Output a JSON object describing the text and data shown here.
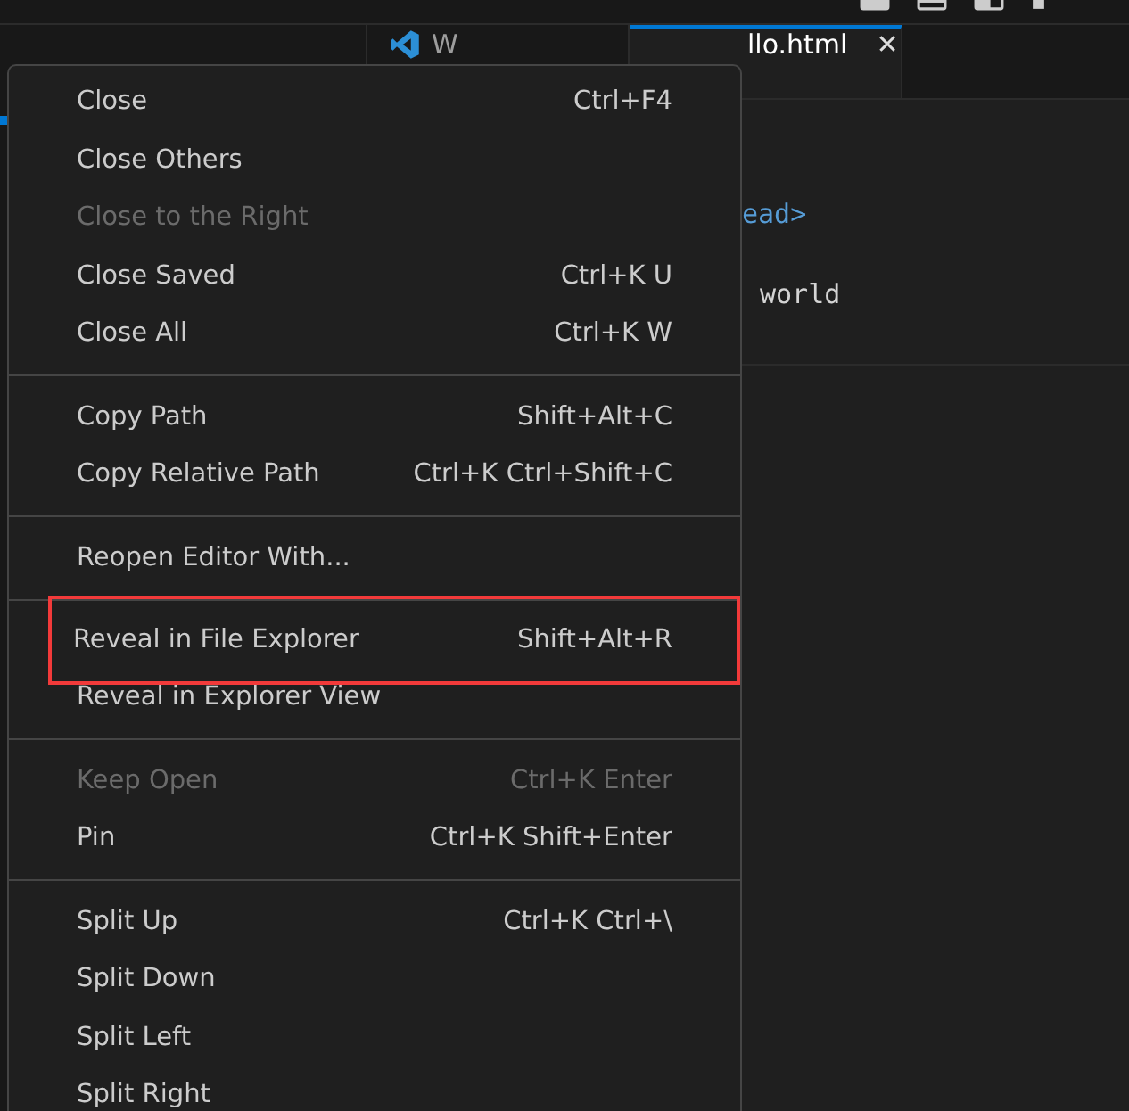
{
  "tabs": [
    {
      "label": "W",
      "selected": false
    },
    {
      "label": "llo.html",
      "selected": true,
      "close": "✕"
    }
  ],
  "editor": {
    "lines": [
      {
        "text": "ead>",
        "kind": "tag"
      },
      {
        "text": "world",
        "kind": "text"
      }
    ]
  },
  "context_menu": {
    "items": [
      {
        "kind": "item",
        "label": "Close",
        "shortcut": "Ctrl+F4",
        "disabled": false,
        "highlighted": false
      },
      {
        "kind": "item",
        "label": "Close Others",
        "disabled": false,
        "highlighted": false
      },
      {
        "kind": "item",
        "label": "Close to the Right",
        "disabled": true,
        "highlighted": false
      },
      {
        "kind": "item",
        "label": "Close Saved",
        "shortcut": "Ctrl+K U",
        "disabled": false,
        "highlighted": false
      },
      {
        "kind": "item",
        "label": "Close All",
        "shortcut": "Ctrl+K W",
        "disabled": false,
        "highlighted": false
      },
      {
        "kind": "separator"
      },
      {
        "kind": "item",
        "label": "Copy Path",
        "shortcut": "Shift+Alt+C",
        "disabled": false,
        "highlighted": false
      },
      {
        "kind": "item",
        "label": "Copy Relative Path",
        "shortcut": "Ctrl+K Ctrl+Shift+C",
        "disabled": false,
        "highlighted": false
      },
      {
        "kind": "separator"
      },
      {
        "kind": "item",
        "label": "Reopen Editor With...",
        "disabled": false,
        "highlighted": false
      },
      {
        "kind": "separator"
      },
      {
        "kind": "item",
        "label": "Reveal in File Explorer",
        "shortcut": "Shift+Alt+R",
        "disabled": false,
        "highlighted": true
      },
      {
        "kind": "item",
        "label": "Reveal in Explorer View",
        "disabled": false,
        "highlighted": false
      },
      {
        "kind": "separator"
      },
      {
        "kind": "item",
        "label": "Keep Open",
        "shortcut": "Ctrl+K Enter",
        "disabled": true,
        "highlighted": false
      },
      {
        "kind": "item",
        "label": "Pin",
        "shortcut": "Ctrl+K Shift+Enter",
        "disabled": false,
        "highlighted": false
      },
      {
        "kind": "separator"
      },
      {
        "kind": "item",
        "label": "Split Up",
        "shortcut": "Ctrl+K Ctrl+\\",
        "disabled": false,
        "highlighted": false
      },
      {
        "kind": "item",
        "label": "Split Down",
        "disabled": false,
        "highlighted": false
      },
      {
        "kind": "item",
        "label": "Split Left",
        "disabled": false,
        "highlighted": false
      },
      {
        "kind": "item",
        "label": "Split Right",
        "disabled": false,
        "highlighted": false
      }
    ]
  }
}
